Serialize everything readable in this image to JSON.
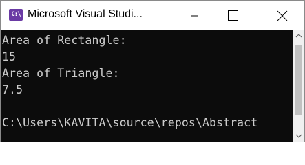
{
  "window": {
    "title": "Microsoft Visual Studi...",
    "icon": "visual-studio-console-icon",
    "controls": [
      "minimize-icon",
      "maximize-icon",
      "close-icon"
    ]
  },
  "console": {
    "lines": [
      "Area of Rectangle:",
      "15",
      "Area of Triangle:",
      "7.5",
      "",
      "C:\\Users\\KAVITA\\source\\repos\\Abstract"
    ]
  },
  "colors": {
    "console_background": "#0c0c0c",
    "console_text": "#cccccc",
    "titlebar_background": "#ffffff",
    "icon_accent": "#6a3aa4"
  }
}
